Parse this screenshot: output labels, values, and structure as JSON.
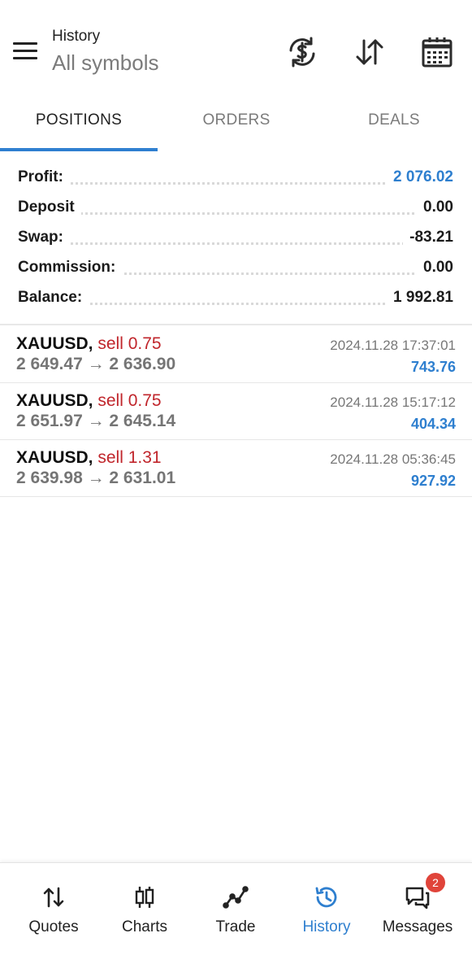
{
  "header": {
    "title": "History",
    "subtitle": "All symbols",
    "icons": [
      "menu-icon",
      "currency-exchange-icon",
      "sort-icon",
      "calendar-icon"
    ]
  },
  "tabs": [
    {
      "label": "POSITIONS",
      "active": true
    },
    {
      "label": "ORDERS",
      "active": false
    },
    {
      "label": "DEALS",
      "active": false
    }
  ],
  "summary": {
    "profit": {
      "label": "Profit:",
      "value": "2 076.02"
    },
    "deposit": {
      "label": "Deposit",
      "value": "0.00"
    },
    "swap": {
      "label": "Swap:",
      "value": "-83.21"
    },
    "commission": {
      "label": "Commission:",
      "value": "0.00"
    },
    "balance": {
      "label": "Balance:",
      "value": "1 992.81"
    }
  },
  "deals": [
    {
      "symbol": "XAUUSD,",
      "type": "sell 0.75",
      "prices": "2 649.47 → 2 636.90",
      "time": "2024.11.28 17:37:01",
      "profit": "743.76"
    },
    {
      "symbol": "XAUUSD,",
      "type": "sell 0.75",
      "prices": "2 651.97 → 2 645.14",
      "time": "2024.11.28 15:17:12",
      "profit": "404.34"
    },
    {
      "symbol": "XAUUSD,",
      "type": "sell 1.31",
      "prices": "2 639.98 → 2 631.01",
      "time": "2024.11.28 05:36:45",
      "profit": "927.92"
    }
  ],
  "nav": {
    "quotes": {
      "label": "Quotes",
      "icon": "quotes-icon"
    },
    "charts": {
      "label": "Charts",
      "icon": "charts-icon"
    },
    "trade": {
      "label": "Trade",
      "icon": "trade-icon"
    },
    "history": {
      "label": "History",
      "icon": "history-icon",
      "active": true
    },
    "messages": {
      "label": "Messages",
      "icon": "messages-icon",
      "badge": "2"
    }
  },
  "colors": {
    "accent": "#2e7fcf",
    "sell": "#c0252b",
    "badge": "#e0443a"
  }
}
